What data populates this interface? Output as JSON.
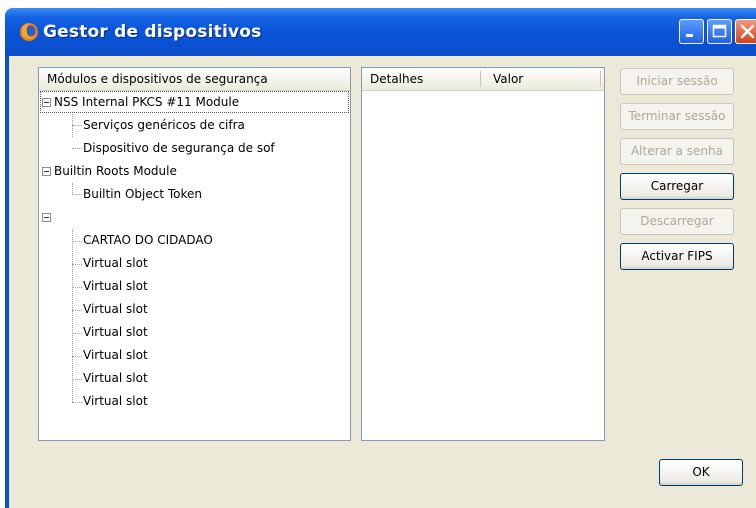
{
  "window": {
    "title": "Gestor de dispositivos"
  },
  "tree": {
    "header": "Módulos e dispositivos de segurança",
    "items": [
      {
        "label": "NSS Internal PKCS #11 Module",
        "level": 0,
        "expanded": true,
        "selected": true
      },
      {
        "label": "Serviços genéricos de cifra",
        "level": 1
      },
      {
        "label": "Dispositivo de segurança de sof",
        "level": 1
      },
      {
        "label": "Builtin Roots Module",
        "level": 0,
        "expanded": true
      },
      {
        "label": "Builtin Object Token",
        "level": 1
      },
      {
        "label": "",
        "level": 0,
        "expanded": true
      },
      {
        "label": "CARTAO DO CIDADAO",
        "level": 1
      },
      {
        "label": "Virtual slot",
        "level": 1
      },
      {
        "label": "Virtual slot",
        "level": 1
      },
      {
        "label": "Virtual slot",
        "level": 1
      },
      {
        "label": "Virtual slot",
        "level": 1
      },
      {
        "label": "Virtual slot",
        "level": 1
      },
      {
        "label": "Virtual slot",
        "level": 1
      },
      {
        "label": "Virtual slot",
        "level": 1
      }
    ]
  },
  "details": {
    "col_details": "Detalhes",
    "col_value": "Valor"
  },
  "buttons": {
    "login": "Iniciar sessão",
    "logout": "Terminar sessão",
    "change_password": "Alterar a senha",
    "load": "Carregar",
    "unload": "Descarregar",
    "enable_fips": "Activar FIPS",
    "ok": "OK"
  },
  "icons": {
    "app": "firefox-icon",
    "minimize": "minimize-icon",
    "maximize": "maximize-icon",
    "close": "close-icon"
  },
  "colors": {
    "titlebar": "#0a55d9",
    "client": "#ece9d8",
    "close_button": "#d0401a"
  }
}
